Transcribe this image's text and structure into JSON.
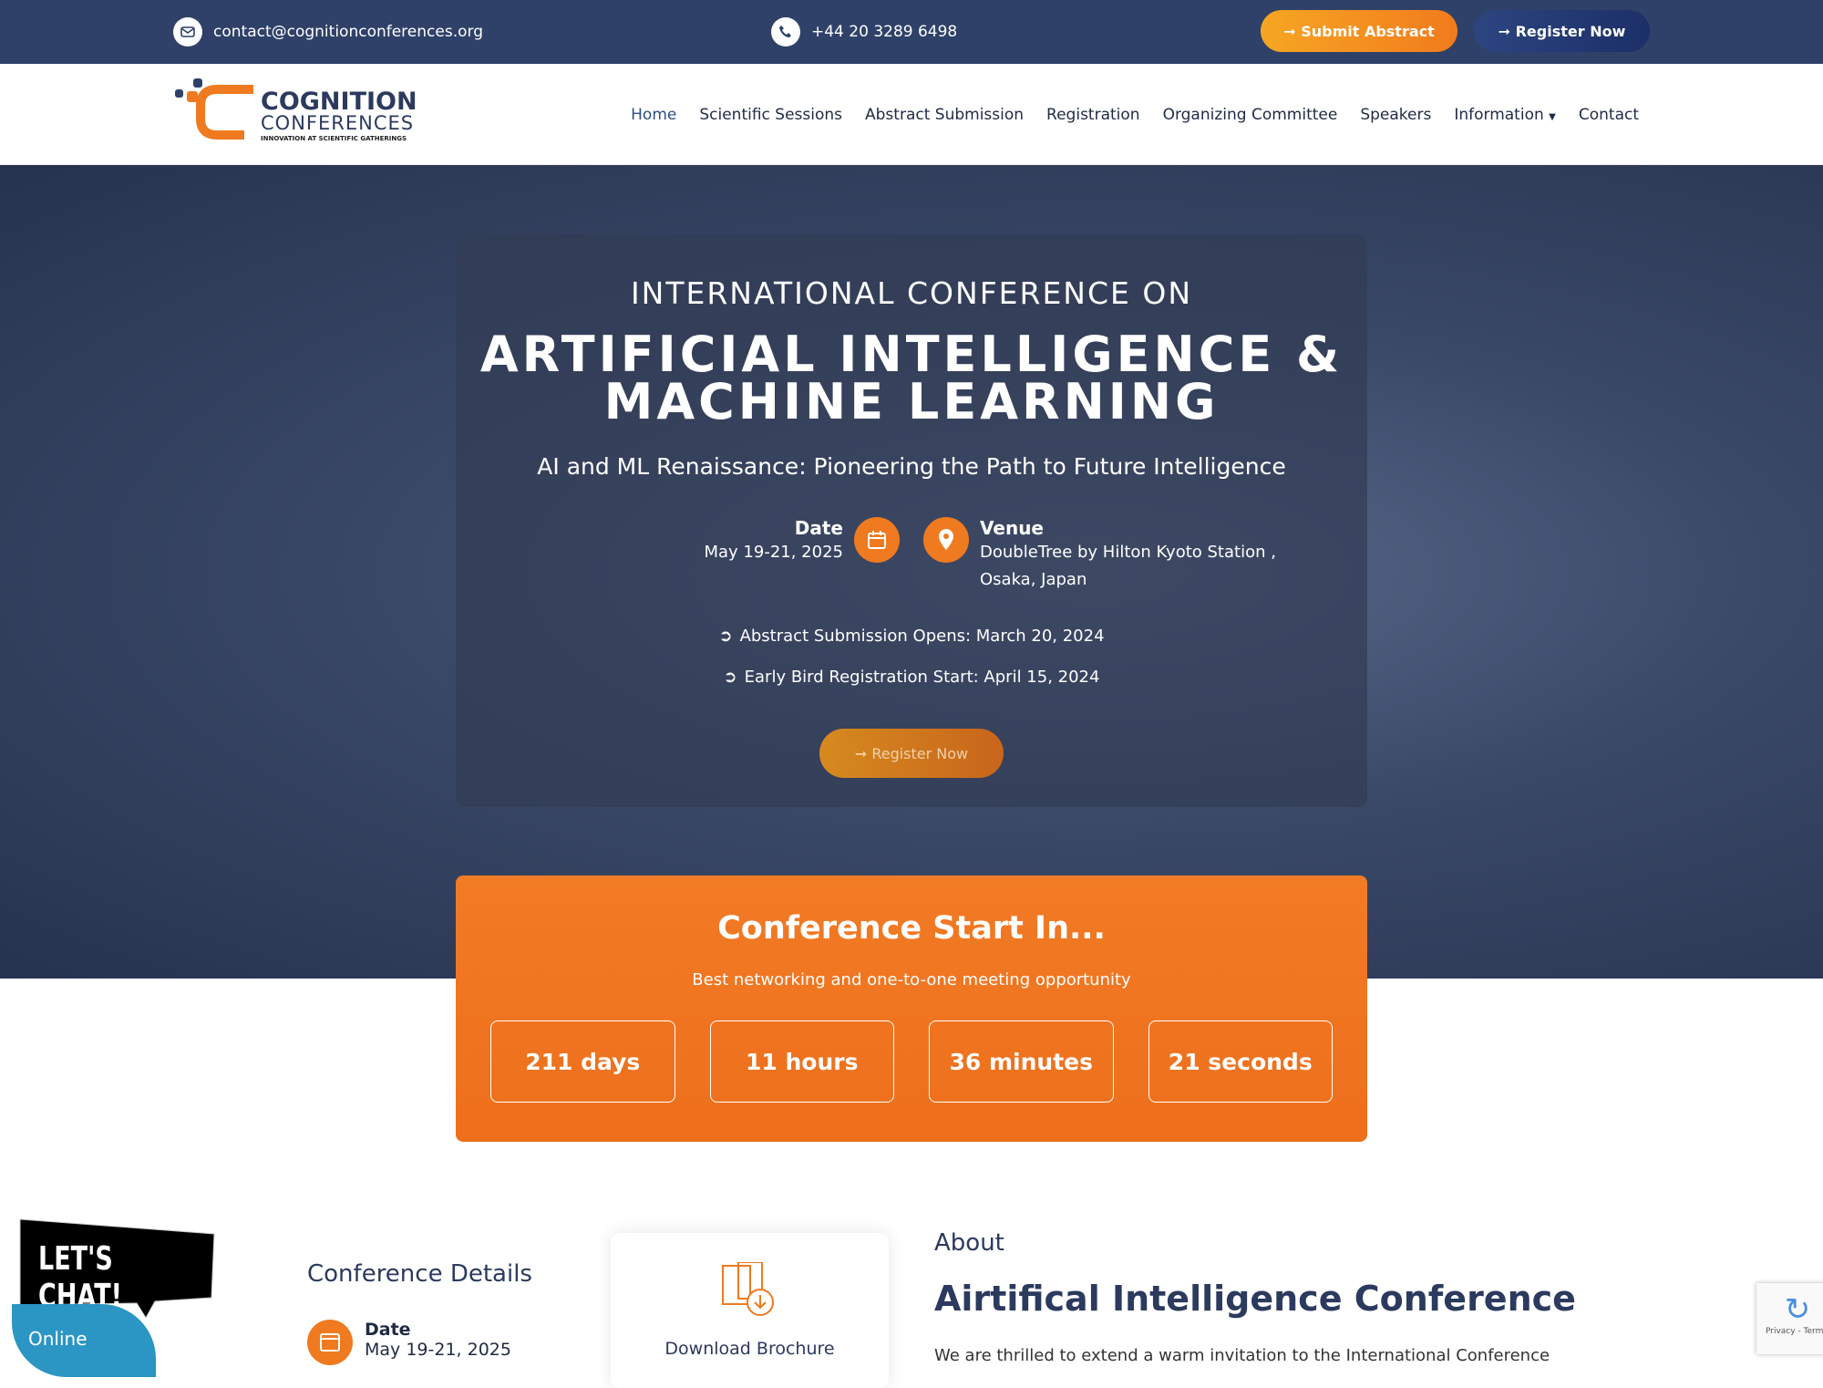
{
  "topbar": {
    "email": "contact@cognitionconferences.org",
    "phone": "+44 20 3289 6498",
    "submit_label": "➞ Submit Abstract",
    "register_label": "➞ Register Now"
  },
  "logo": {
    "name": "COGNITION",
    "sub": "CONFERENCES",
    "tagline": "INNOVATION AT SCIENTIFIC GATHERINGS"
  },
  "nav": {
    "items": [
      "Home",
      "Scientific Sessions",
      "Abstract Submission",
      "Registration",
      "Organizing Committee",
      "Speakers",
      "Information",
      "Contact"
    ]
  },
  "hero": {
    "pre": "INTERNATIONAL  CONFERENCE  ON",
    "title1": "ARTIFICIAL INTELLIGENCE &",
    "title2": "MACHINE LEARNING",
    "subtitle": "AI and ML Renaissance: Pioneering the Path to Future Intelligence",
    "date_label": "Date",
    "date_value": "May 19-21, 2025",
    "venue_label": "Venue",
    "venue_line1": "DoubleTree by Hilton Kyoto Station ,",
    "venue_line2": "Osaka, Japan",
    "deadline1": "Abstract Submission Opens: March 20, 2024",
    "deadline2": "Early Bird Registration Start: April 15, 2024",
    "register_label": "➞ Register Now"
  },
  "countdown": {
    "title": "Conference Start In...",
    "subtitle": "Best networking and one-to-one meeting opportunity",
    "days": "211 days",
    "hours": "11 hours",
    "minutes": "36 minutes",
    "seconds": "21 seconds"
  },
  "chat": {
    "label": "LET'S CHAT!",
    "status": "Online"
  },
  "details": {
    "title": "Conference Details",
    "date_label": "Date",
    "date_value": "May 19-21, 2025"
  },
  "brochure": {
    "label": "Download Brochure"
  },
  "about": {
    "kicker": "About",
    "heading": "Airtifical Intelligence Conference",
    "text": "We are thrilled to extend a warm invitation to the International Conference"
  },
  "recaptcha": {
    "text": "Privacy - Terms"
  },
  "colors": {
    "navy": "#2f4168",
    "orange": "#f07a1f",
    "chat_blue": "#2b95c4"
  }
}
